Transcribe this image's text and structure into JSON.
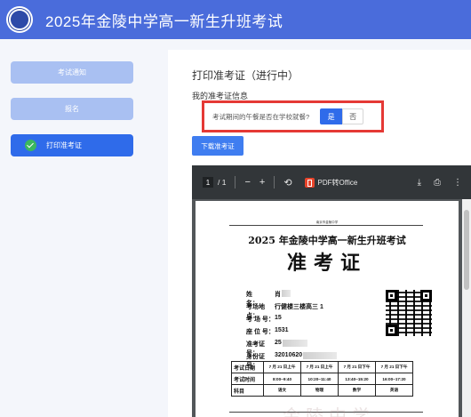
{
  "app": {
    "title": "2025年金陵中学高一新生升班考试"
  },
  "sidebar": {
    "items": [
      {
        "label": "考试通知"
      },
      {
        "label": "报名"
      },
      {
        "label": "打印准考证"
      }
    ]
  },
  "main": {
    "page_title": "打印准考证（进行中）",
    "subtitle": "我的准考证信息",
    "question": {
      "text": "考试期间的午餐是否在学校就餐?",
      "yes": "是",
      "no": "否",
      "selected": "是"
    },
    "download_button": "下载准考证"
  },
  "pdf_viewer": {
    "page_current": "1",
    "page_total": "/ 1",
    "zoom_out": "−",
    "zoom_in": "+",
    "office_label": "PDF转Office"
  },
  "ticket": {
    "org": "南京市金陵中学",
    "title": "2025 年金陵中学高一新生升班考试",
    "subtitle": "准考证",
    "fields": [
      {
        "label": "姓　　名：",
        "value": "肖"
      },
      {
        "label": "考场地点：",
        "value": "行健楼三楼高三 1"
      },
      {
        "label": "考 场 号：",
        "value": "15"
      },
      {
        "label": "座 位 号：",
        "value": "1531"
      },
      {
        "label": "准考证号：",
        "value": "25"
      },
      {
        "label": "身份证号：",
        "value": "32010620"
      }
    ],
    "schedule": {
      "row_labels": [
        "考试日期",
        "考试时间",
        "科目"
      ],
      "dates": [
        "7 月 21 日上午",
        "7 月 21 日上午",
        "7 月 21 日下午",
        "7 月 21 日下午"
      ],
      "times": [
        "8:00~9:40",
        "10:20~11:40",
        "13:40~15:20",
        "16:00~17:20"
      ],
      "subjects": [
        "语文",
        "物理",
        "数学",
        "英语"
      ]
    },
    "watermark": "金陵中学"
  }
}
